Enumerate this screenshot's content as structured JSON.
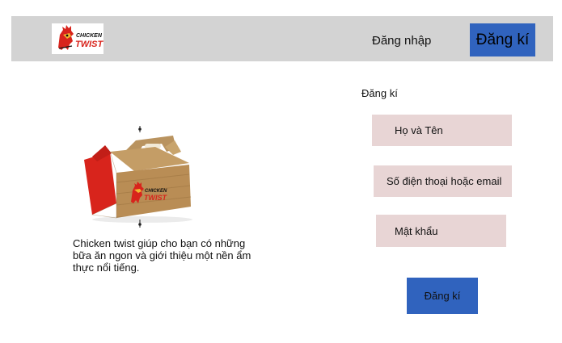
{
  "header": {
    "logo_text_top": "CHICKEN",
    "logo_text_bottom": "TWIST",
    "login_label": "Đăng nhập",
    "register_label": "Đăng kí"
  },
  "main": {
    "description": "Chicken twist giúp cho bạn có những bữa ăn ngon và giới thiệu một nền ẩm thực nổi tiếng."
  },
  "form": {
    "title": "Đăng kí",
    "name_placeholder": "Họ và Tên",
    "contact_placeholder": "Số điện thoại hoặc email",
    "password_placeholder": "Mật khẩu",
    "submit_label": "Đăng kí"
  },
  "colors": {
    "header_bg": "#d3d3d3",
    "button_blue": "#3063be",
    "field_bg": "#e8d5d5",
    "brand_red": "#d8241c"
  },
  "icons": {
    "logo": "rooster-logo",
    "product": "chicken-box-image"
  }
}
